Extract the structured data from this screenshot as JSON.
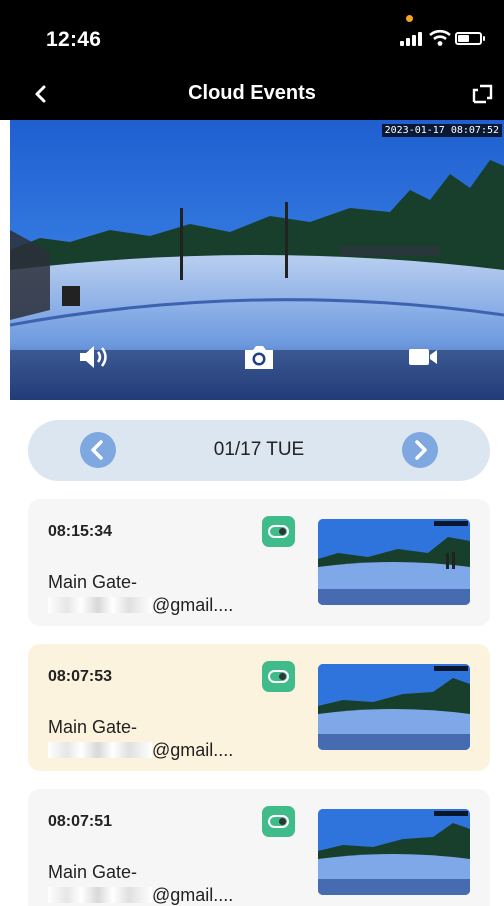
{
  "status_bar": {
    "time": "12:46"
  },
  "nav": {
    "title": "Cloud Events",
    "back_icon": "chevron-left-icon",
    "fullscreen_icon": "fullscreen-icon"
  },
  "video": {
    "timestamp": "2023-01-17 08:07:52",
    "controls": [
      "speaker-icon",
      "camera-icon",
      "video-record-icon"
    ]
  },
  "date_selector": {
    "date": "01/17 TUE",
    "prev_icon": "chevron-left-icon",
    "next_icon": "chevron-right-icon",
    "accent": "#7fa7e0",
    "background": "#dce6f1"
  },
  "events": [
    {
      "time": "08:15:34",
      "title": "Main Gate-",
      "account": "@gmail....",
      "selected": false
    },
    {
      "time": "08:07:53",
      "title": "Main Gate-",
      "account": "@gmail....",
      "selected": true
    },
    {
      "time": "08:07:51",
      "title": "Main Gate-",
      "account": "@gmail....",
      "selected": false
    }
  ],
  "colors": {
    "badge": "#3fbc8a",
    "selected_row": "#fbf3de",
    "row": "#f6f6f6"
  }
}
